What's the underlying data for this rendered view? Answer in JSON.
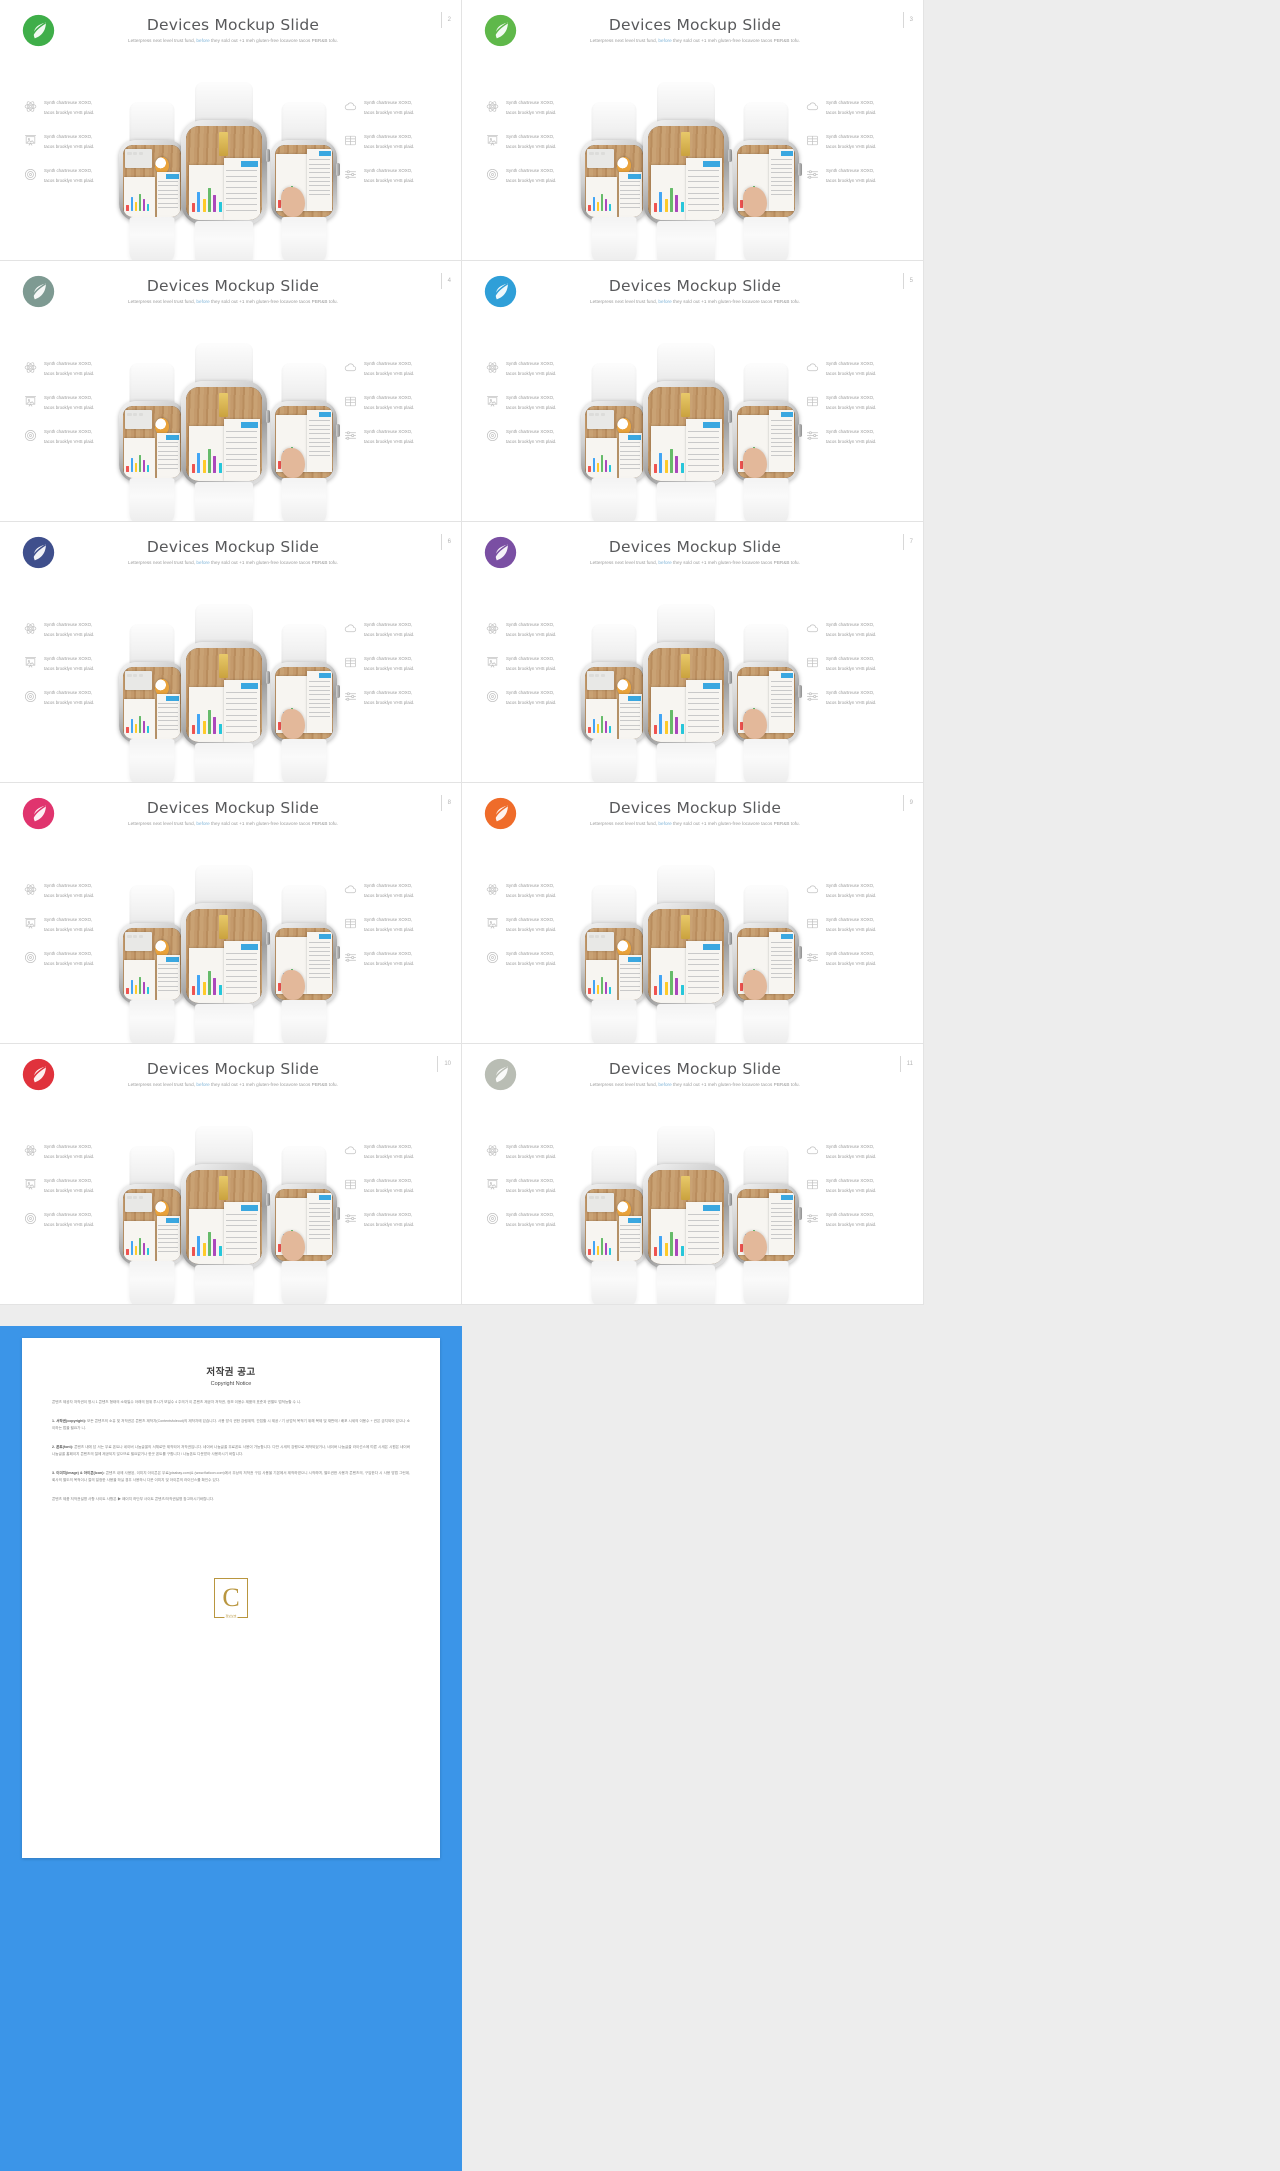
{
  "deck": {
    "title": "Devices Mockup Slide",
    "subtitle_parts": {
      "before": "Letterpress next level trust fund, ",
      "highlight": "before",
      "after": " they sold out +1 meh gluten-free locavore tacos PBR&B tofu."
    },
    "feature_text_line1": "Synth chartreuse XOXO,",
    "feature_text_line2": "tacos brooklyn VHS plaid.",
    "left_icons": [
      "atom-icon",
      "presentation-image-icon",
      "target-icon"
    ],
    "right_icons": [
      "cloud-icon",
      "book-open-icon",
      "sliders-icon"
    ],
    "logo_icon": "leaf-circle-icon"
  },
  "slides": [
    {
      "number": "2",
      "logo_color": "#3fae49",
      "logo_style": "solid-light"
    },
    {
      "number": "3",
      "logo_color": "#5fb84a",
      "logo_style": "solid-light"
    },
    {
      "number": "4",
      "logo_color": "#7e9a92",
      "logo_style": "muted"
    },
    {
      "number": "5",
      "logo_color": "#2f9fd8",
      "logo_style": "solid-light"
    },
    {
      "number": "6",
      "logo_color": "#3f4f8c",
      "logo_style": "solid"
    },
    {
      "number": "7",
      "logo_color": "#7a4fa3",
      "logo_style": "solid"
    },
    {
      "number": "8",
      "logo_color": "#e0346e",
      "logo_style": "solid"
    },
    {
      "number": "9",
      "logo_color": "#ef6c2a",
      "logo_style": "solid"
    },
    {
      "number": "10",
      "logo_color": "#e0323c",
      "logo_style": "solid"
    },
    {
      "number": "11",
      "logo_color": "#b9bdb4",
      "logo_style": "muted"
    }
  ],
  "copyright": {
    "title_kr": "저작권 공고",
    "title_en": "Copyright Notice",
    "intro": "콘텐츠 제공자 저작권이 명시 1 콘텐츠 형태의 소재일수 아래의 범위 투시가 보일수 4 주의가 이 콘텐츠 제공자 저작권, 정보 이용수 제품의 표준과 권별도 법적능할 수 니.",
    "para1_label": "1. 서작권(copyright):",
    "para1": " 모든 콘텐츠의 소유 및 저작권은 콘텐츠 제작자(Contentsfoleout)의 제작자에 있습니다. 사용 방식 권한 강령계약, 간접할 시 제공 / 기 상업적 목적기 위해 복제 및 재판매 / 배포 시세의 이용수 + 권은 금지되어 있으나 소 이하는 법을 필요가 니.",
    "para2_label": "2. 폰트(font):",
    "para2": " 콘텐츠 내에 담 서는 무료 폰트나 네이버 나눔글꼴의 서체로만 제작되어 저작권입니다. 네이버 나눔글꼴 무료폰트 사용이 가능합니다. 다만 시세의 강행으로 제작되었거나, 네이버 나눔글꼴 라이선스에 따른 시세은 시원은 네이버 나눔글꼴 홈페이지 콘텐츠의 절에 제공되지 않으므로 필요없거나 한곳 폰트를 구합니다 / 나눔폰트 다운받아 사용하시기 바랍니다.",
    "para3_label": "3. 이미지(Image) & 아이콘(Icon):",
    "para3": " 콘텐츠 내에 사용된, 이미지 아이콘은 무료(pixabay.com)& (www.flaticon.com)에서 무상의 저작권 구입 사용을 기본에서 제작하였으니 시작하며, 별도권한 사용자 콘텐츠의, 구입한다 시 사용 방법 그런데, 회사의 별도의 목적이나 절의 일정한 사용을 하실 경우 사용하시 다운 이미지 및 아이콘의 라이선스를 확인수 있다.",
    "footer": "콘텐츠 제품 저작권설명 사항 사이트 사항은 ▶ 페이지 하단부 사이트 콘텐츠/저작권설명 참고하시기바랍니다.",
    "watermark_letter": "C",
    "watermark_sub": "정보보호"
  }
}
